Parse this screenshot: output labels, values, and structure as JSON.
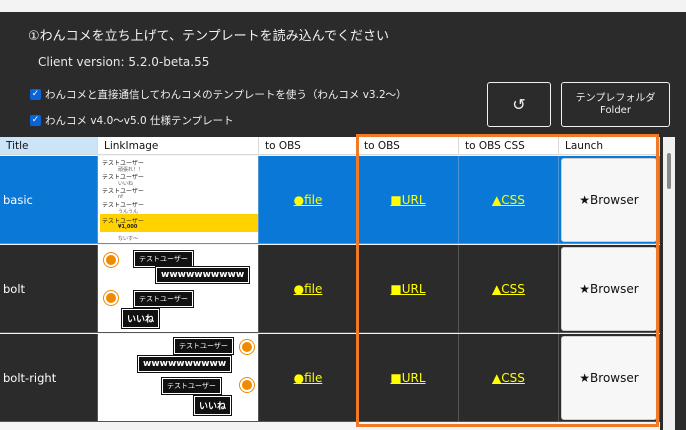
{
  "heading": "①わんコメを立ち上げて、テンプレートを読み込んでください",
  "client_version": "Client version: 5.2.0-beta.55",
  "options": [
    {
      "label": "わんコメと直接通信してわんコメのテンプレートを使う（わんコメ v3.2〜）",
      "checked": true
    },
    {
      "label": "わんコメ v4.0〜v5.0 仕様テンプレート",
      "checked": true
    }
  ],
  "buttons": {
    "reload_icon": "↺",
    "folder_line1": "テンプレフォルダ",
    "folder_line2": "Folder"
  },
  "columns": [
    "Title",
    "LinkImage",
    "to OBS",
    "to OBS",
    "to OBS CSS",
    "Launch"
  ],
  "rows": [
    {
      "title": "basic",
      "selected": true,
      "file": "●file",
      "url": "■URL",
      "css": "▲CSS",
      "launch": "★Browser"
    },
    {
      "title": "bolt",
      "selected": false,
      "file": "●file",
      "url": "■URL",
      "css": "▲CSS",
      "launch": "★Browser"
    },
    {
      "title": "bolt-right",
      "selected": false,
      "file": "●file",
      "url": "■URL",
      "css": "▲CSS",
      "launch": "★Browser"
    }
  ],
  "previews": {
    "user": "テストユーザー",
    "basic_lines": [
      "テストユーザー",
      "テストユーザー",
      "テストユーザー",
      "テストユーザー",
      "テストユーザー"
    ],
    "basic_subs": [
      "頑張れ！！",
      "いいね",
      "nf",
      "うんうん",
      "¥1,000",
      "ないす〜"
    ],
    "amount": "¥1,000",
    "www": "wwwwwwwwww",
    "nf": "nf",
    "iine": "いいね"
  },
  "colors": {
    "accent": "#0a78d6",
    "link": "#ffff00",
    "highlight_frame": "#f07a28"
  }
}
